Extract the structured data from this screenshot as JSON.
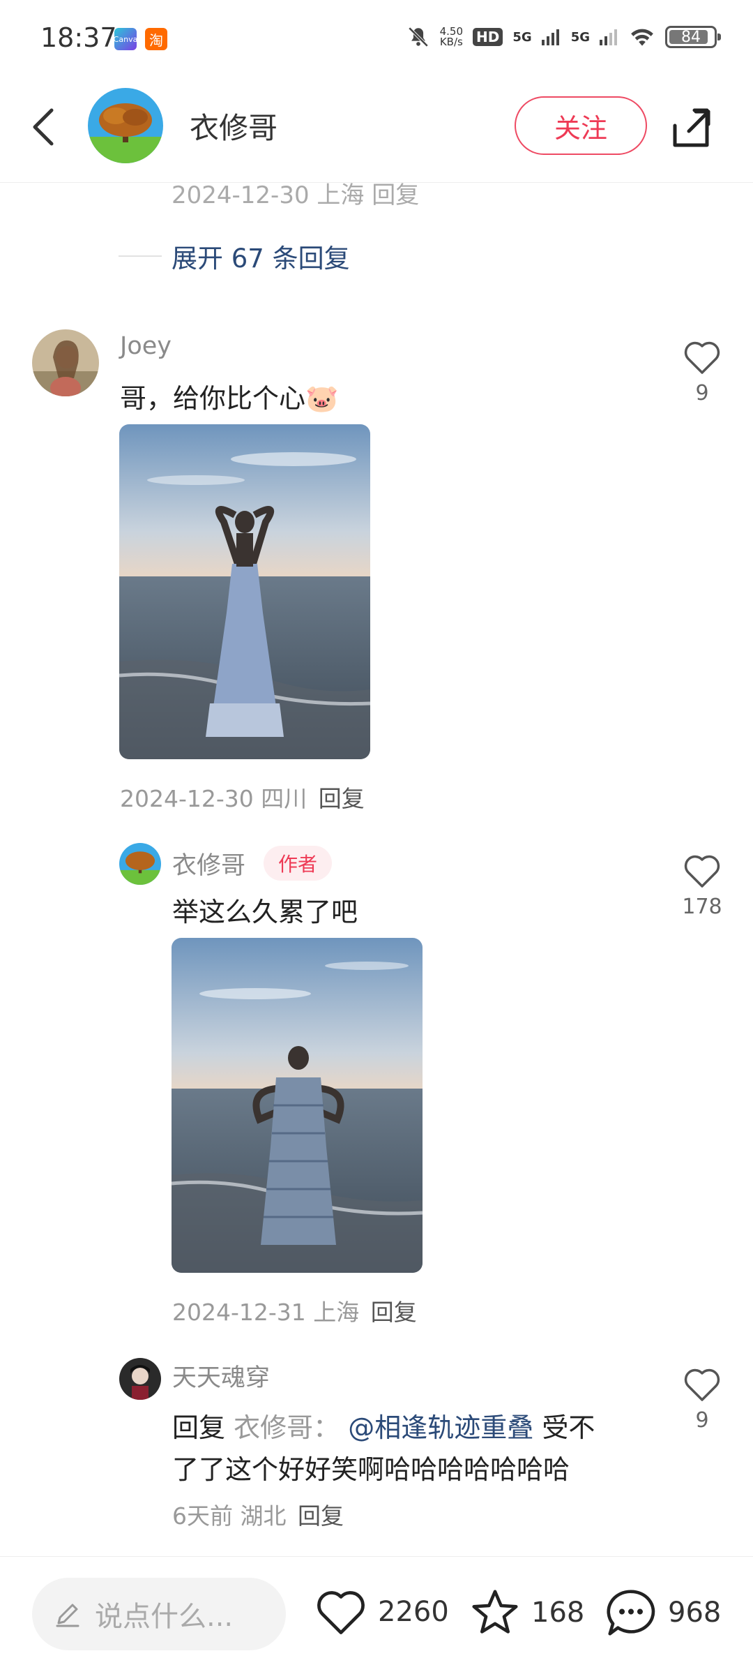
{
  "status_bar": {
    "time": "18:37",
    "app_icons": [
      "Canva",
      "淘"
    ],
    "net_speed_value": "4.50",
    "net_speed_unit": "KB/s",
    "hd_label": "HD",
    "signal1": "5G",
    "signal2": "5G",
    "battery": "84"
  },
  "header": {
    "author_name": "衣修哥",
    "follow_label": "关注"
  },
  "clipped_meta": "2024-12-30 上海 回复",
  "expand_replies": "展开 67 条回复",
  "comments": [
    {
      "username": "Joey",
      "text": "哥，给你比个心🐷",
      "meta": "2024-12-30 四川",
      "reply_label": "回复",
      "likes": "9"
    },
    {
      "username": "衣修哥",
      "badge": "作者",
      "text": "举这么久累了吧",
      "meta": "2024-12-31 上海",
      "reply_label": "回复",
      "likes": "178"
    },
    {
      "username": "天天魂穿",
      "reply_prefix": "回复",
      "reply_to": "衣修哥：",
      "mention": "@相逢轨迹重叠",
      "text_line1": "受不",
      "text_line2": "了了这个好好笑啊哈哈哈哈哈哈哈",
      "meta": "6天前  湖北",
      "reply_label": "回复",
      "likes": "9"
    }
  ],
  "bottom_bar": {
    "input_placeholder": "说点什么...",
    "like_count": "2260",
    "star_count": "168",
    "comment_count": "968"
  }
}
